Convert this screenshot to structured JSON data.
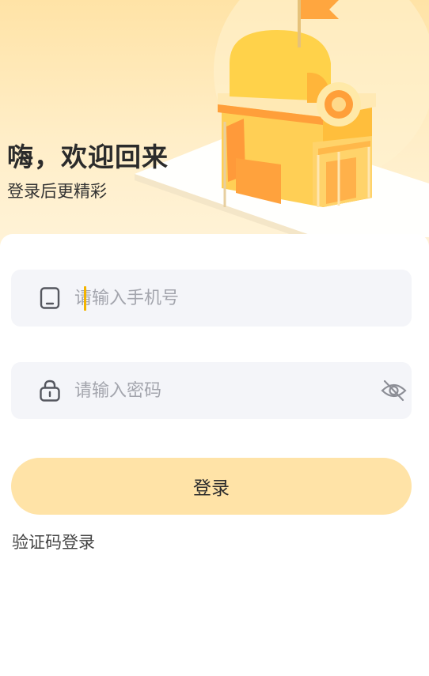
{
  "header": {
    "title": "嗨，欢迎回来",
    "subtitle": "登录后更精彩"
  },
  "form": {
    "phone": {
      "placeholder": "请输入手机号",
      "value": ""
    },
    "password": {
      "placeholder": "请输入密码",
      "value": ""
    },
    "login_label": "登录",
    "sms_login_label": "验证码登录"
  },
  "colors": {
    "banner_bg": "#ffe3a6",
    "field_bg": "#f4f5f9",
    "login_button_bg": "#ffe3a7",
    "caret": "#f3b400",
    "house_orange": "#ffb347",
    "house_yellow": "#ffd766"
  },
  "icons": {
    "phone": "phone-icon",
    "lock": "lock-icon",
    "eye_off": "eye-off-icon",
    "illustration": "house-illustration"
  }
}
